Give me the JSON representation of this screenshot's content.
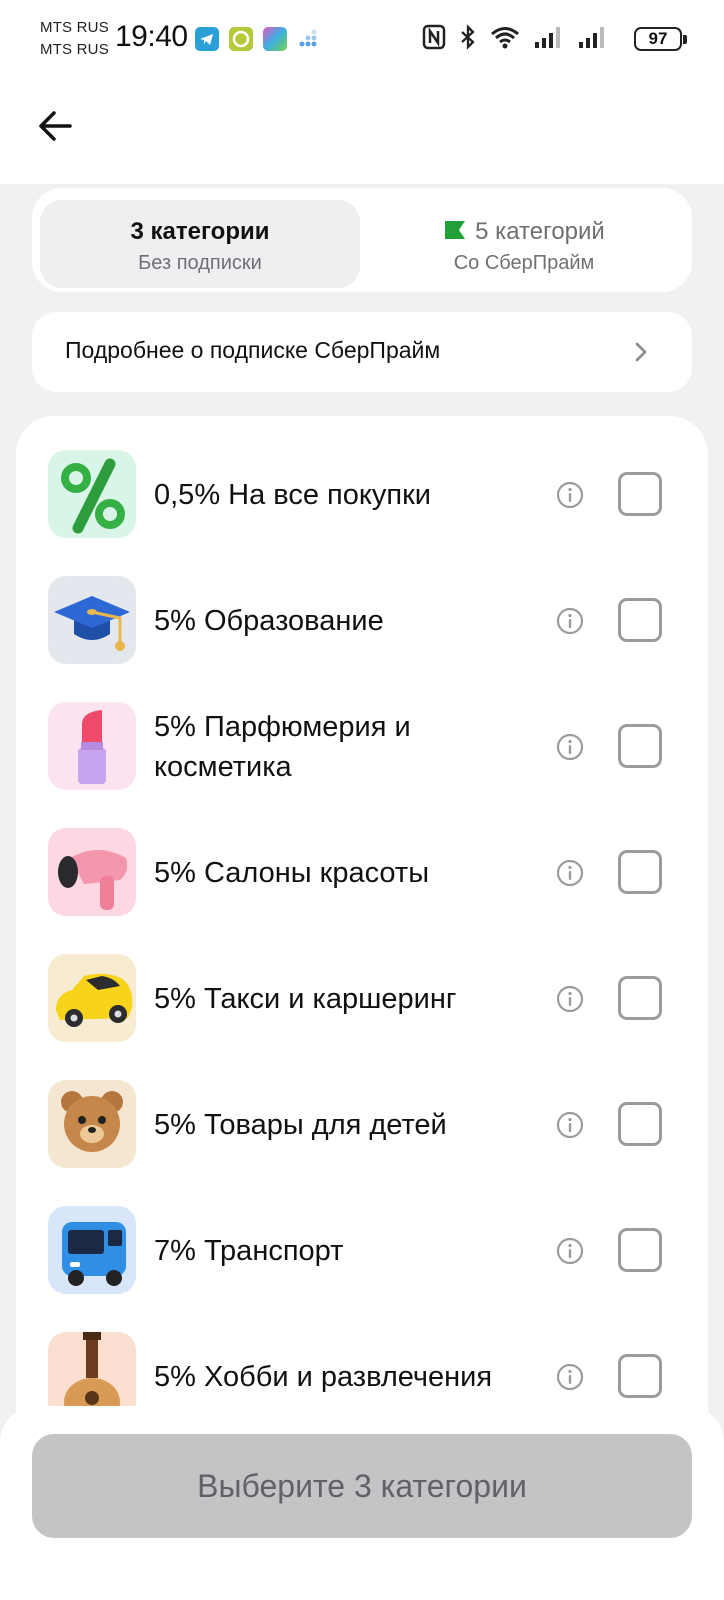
{
  "status_bar": {
    "carrier1": "MTS RUS",
    "carrier2": "MTS RUS",
    "time": "19:40",
    "battery": "97"
  },
  "segments": [
    {
      "title": "3 категории",
      "subtitle": "Без подписки",
      "active": true
    },
    {
      "title": "5 категорий",
      "subtitle": "Со СберПрайм",
      "active": false
    }
  ],
  "subscription_link": "Подробнее о подписке СберПрайм",
  "categories": [
    {
      "label": "0,5% На все покупки",
      "icon": "percent-icon",
      "checked": false
    },
    {
      "label": "5% Образование",
      "icon": "graduation-cap-icon",
      "checked": false
    },
    {
      "label": "5% Парфюмерия и косметика",
      "icon": "lipstick-icon",
      "checked": false
    },
    {
      "label": "5% Салоны красоты",
      "icon": "hair-dryer-icon",
      "checked": false
    },
    {
      "label": "5% Такси и каршеринг",
      "icon": "taxi-car-icon",
      "checked": false
    },
    {
      "label": "5% Товары для детей",
      "icon": "teddy-bear-icon",
      "checked": false
    },
    {
      "label": "7% Транспорт",
      "icon": "bus-icon",
      "checked": false
    },
    {
      "label": "5% Хобби и развлечения",
      "icon": "guitar-icon",
      "checked": false
    }
  ],
  "cta_label": "Выберите 3 категории",
  "colors": {
    "accent_green": "#21a038",
    "background": "#f1f1f3",
    "button_disabled": "#c4c4c6"
  }
}
